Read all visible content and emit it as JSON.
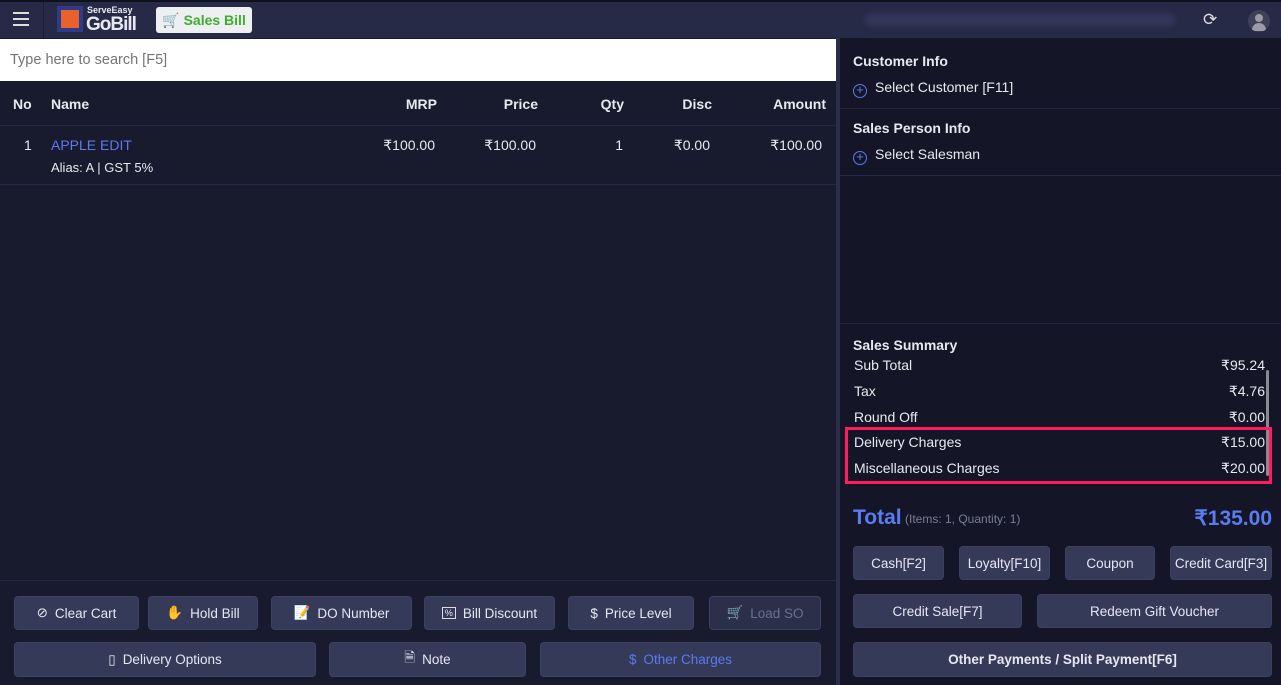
{
  "header": {
    "brand_small": "ServeEasy",
    "brand_big": "GoBill",
    "mode_button": "Sales Bill",
    "icons": [
      "menu-icon",
      "refresh-icon",
      "user-avatar-icon"
    ]
  },
  "search": {
    "placeholder": "Type here to search [F5]"
  },
  "table": {
    "columns": [
      "No",
      "Name",
      "MRP",
      "Price",
      "Qty",
      "Disc",
      "Amount"
    ],
    "rows": [
      {
        "no": "1",
        "name": "APPLE EDIT",
        "sub": "Alias: A | GST 5%",
        "mrp": "₹100.00",
        "price": "₹100.00",
        "qty": "1",
        "disc": "₹0.00",
        "amount": "₹100.00"
      }
    ]
  },
  "actions": {
    "clear_cart": "Clear Cart",
    "hold_bill": "Hold Bill",
    "do_number": "DO Number",
    "bill_discount": "Bill Discount",
    "price_level": "Price Level",
    "load_so": "Load SO",
    "delivery_options": "Delivery Options",
    "note": "Note",
    "other_charges": "Other Charges"
  },
  "customer": {
    "title": "Customer Info",
    "select": "Select Customer [F11]"
  },
  "salesperson": {
    "title": "Sales Person Info",
    "select": "Select Salesman"
  },
  "summary": {
    "title": "Sales Summary",
    "rows": [
      {
        "label": "Sub Total",
        "value": "₹95.24"
      },
      {
        "label": "Tax",
        "value": "₹4.76"
      },
      {
        "label": "Round Off",
        "value": "₹0.00"
      },
      {
        "label": "Delivery Charges",
        "value": "₹15.00"
      },
      {
        "label": "Miscellaneous Charges",
        "value": "₹20.00"
      }
    ],
    "total_label": "Total",
    "total_meta": "(Items: 1, Quantity: 1)",
    "total_value": "₹135.00"
  },
  "payments": {
    "cash": "Cash[F2]",
    "loyalty": "Loyalty[F10]",
    "coupon": "Coupon",
    "credit_card": "Credit Card[F3]",
    "credit_sale": "Credit Sale[F7]",
    "gift_voucher": "Redeem Gift Voucher",
    "other": "Other Payments / Split Payment[F6]"
  },
  "colors": {
    "accent": "#5b7bf0",
    "highlight_box": "#ff1b5e",
    "brand_green": "#3fae2a"
  }
}
